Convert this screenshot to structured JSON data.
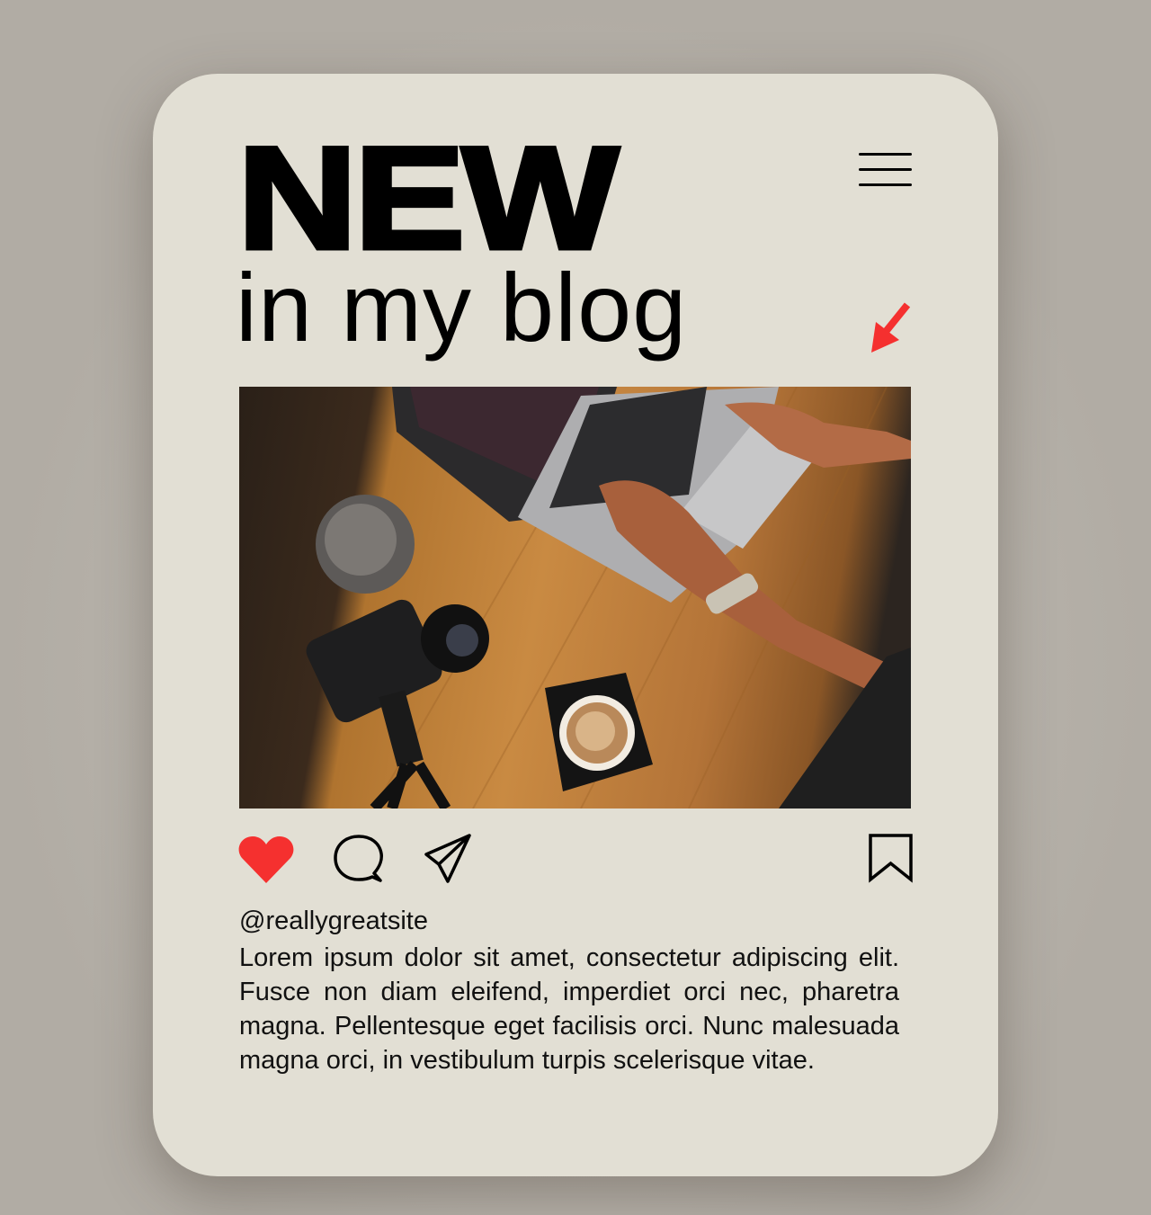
{
  "header": {
    "title": "NEW",
    "subtitle": "in my blog"
  },
  "icons": {
    "menu": "hamburger-menu-icon",
    "arrow": "arrow-down-left-icon",
    "like": "heart-icon",
    "comment": "comment-icon",
    "share": "send-icon",
    "save": "bookmark-icon"
  },
  "colors": {
    "accent": "#f5302f",
    "card": "#e2dfd4",
    "background": "#b3aea6"
  },
  "post": {
    "handle": "@reallygreatsite",
    "caption": "Lorem ipsum dolor sit amet, consectetur adipiscing elit. Fusce non diam eleifend, imperdiet orci nec, pharetra magna. Pellentesque eget facilisis orci. Nunc malesuada magna orci, in vestibulum turpis scelerisque vitae."
  }
}
